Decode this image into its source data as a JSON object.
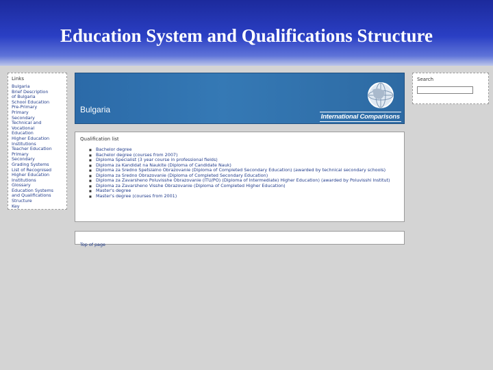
{
  "slide": {
    "title": "Education System and Qualifications Structure"
  },
  "sidebar": {
    "heading": "Links",
    "items": [
      "Bulgaria",
      "Brief Description",
      "of Bulgaria",
      "School Education",
      "Pre-Primary",
      "Primary",
      "Secondary",
      "Technical and",
      "Vocational",
      "Education",
      "Higher Education",
      "Institutions",
      "Teacher Education",
      "Primary",
      "Secondary",
      "Grading Systems",
      "List of Recognised",
      "Higher Education",
      "Institutions",
      "Glossary",
      "Education Systems",
      "and Qualifications",
      "Structure",
      "Key"
    ]
  },
  "banner": {
    "country": "Bulgaria",
    "brand": "International Comparisons",
    "icon": "globe-icon"
  },
  "qualifications": {
    "heading": "Qualification list",
    "items": [
      "Bachelor degree",
      "Bachelor degree (courses from 2007)",
      "Diploma Specialist (3 year course in professional fields)",
      "Diploma za Kandidat na Naukite (Diploma of Candidate Nauk)",
      "Diploma za Sredno Spetsialno Obrazovanie (Diploma of Completed Secondary Education) (awarded by technical secondary schools)",
      "Diploma za Sredno Obrazovanie (Diploma of Completed Secondary Education)",
      "Diploma za Zavarsheno Poluvisshe Obrazovanie (ITU/PO) (Diploma of Intermediate) Higher Education) (awarded by Poluvisshi Institut)",
      "Diploma za Zavarsheno Visshe Obrazovanie (Diploma of Completed Higher Education)",
      "Master's degree",
      "Master's degree (courses from 2001)"
    ]
  },
  "footer": {
    "top_link": "Top of page"
  },
  "search": {
    "label": "Search",
    "value": ""
  }
}
